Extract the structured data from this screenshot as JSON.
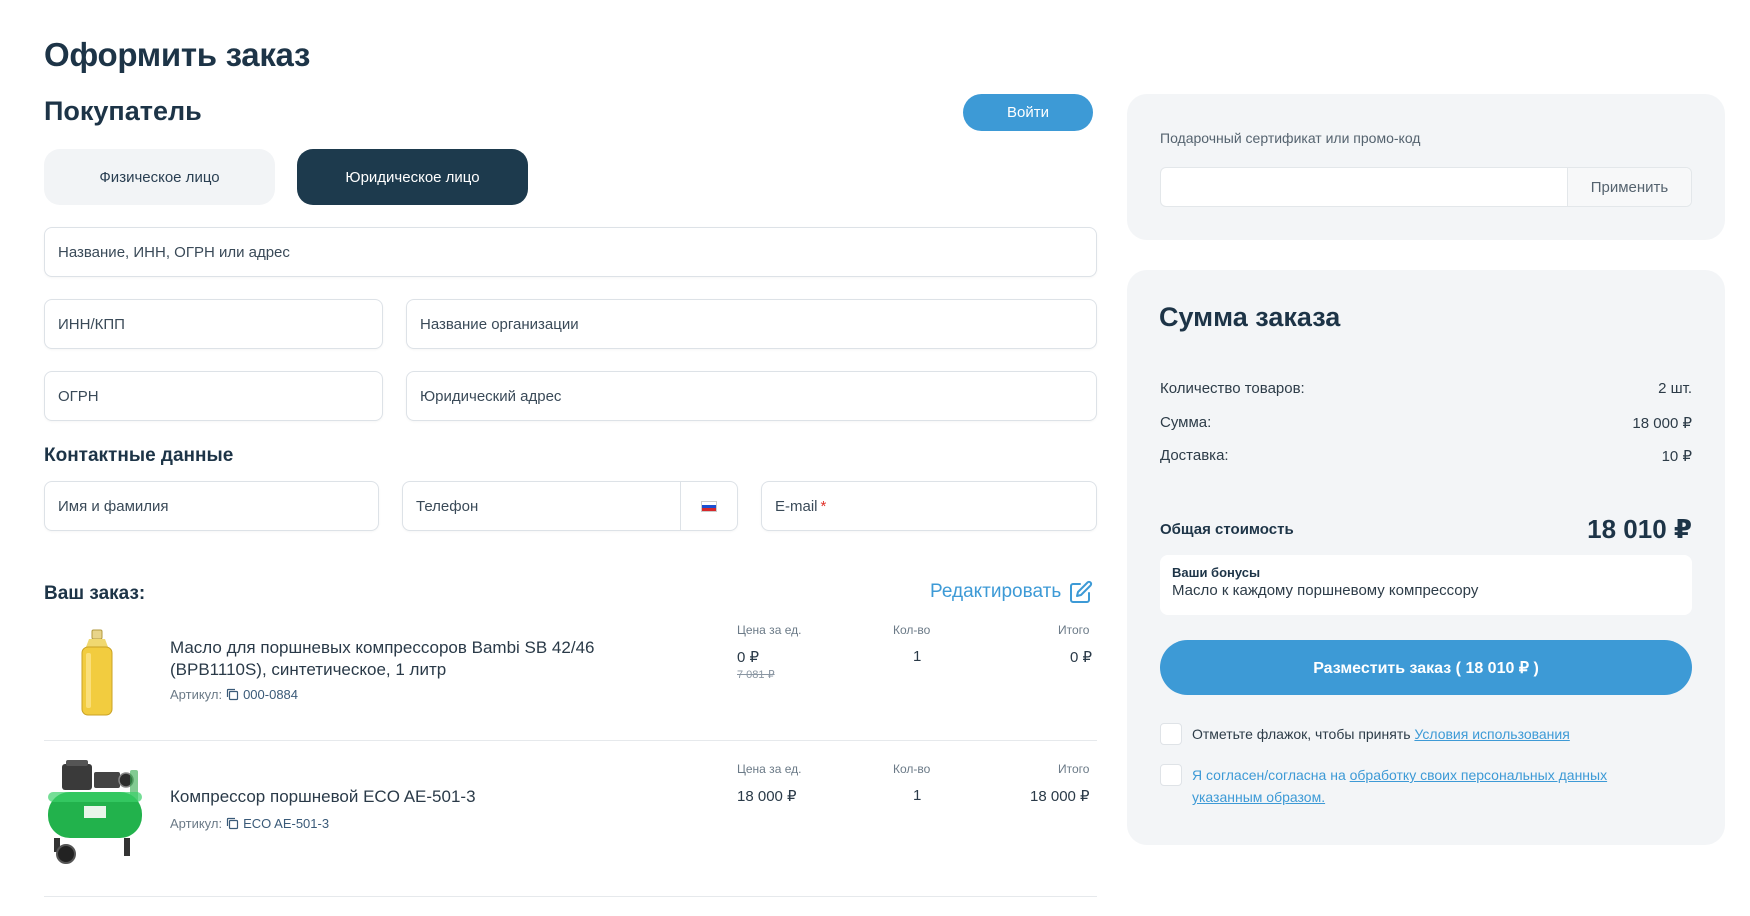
{
  "page": {
    "title": "Оформить заказ"
  },
  "buyer": {
    "title": "Покупатель",
    "login_label": "Войти",
    "tabs": [
      {
        "label": "Физическое лицо",
        "active": false
      },
      {
        "label": "Юридическое лицо",
        "active": true
      }
    ],
    "fields": {
      "search_placeholder": "Название, ИНН, ОГРН или адрес",
      "inn_kpp": "ИНН/КПП",
      "org_name": "Название организации",
      "ogrn": "ОГРН",
      "legal_address": "Юридический адрес"
    }
  },
  "contacts": {
    "title": "Контактные данные",
    "name_placeholder": "Имя и фамилия",
    "phone_placeholder": "Телефон",
    "email_placeholder": "E-mail",
    "email_required_mark": "*"
  },
  "order": {
    "title": "Ваш заказ:",
    "edit_label": "Редактировать",
    "columns": {
      "price": "Цена за ед.",
      "qty": "Кол-во",
      "total": "Итого"
    },
    "items": [
      {
        "name_line1": "Масло для поршневых компрессоров Bambi SB 42/46",
        "name_line2": "(BPB1110S), синтетическое, 1 литр",
        "sku_label": "Артикул:",
        "sku": "000-0884",
        "price": "0 ₽",
        "old_price": "7 081 ₽",
        "qty": "1",
        "total": "0 ₽",
        "image": "oil-bottle"
      },
      {
        "name_line1": "Компрессор поршневой ECO AE-501-3",
        "sku_label": "Артикул:",
        "sku": "ECO AE-501-3",
        "price": "18 000 ₽",
        "qty": "1",
        "total": "18 000 ₽",
        "image": "green-compressor"
      }
    ]
  },
  "promo": {
    "label": "Подарочный сертификат или промо-код",
    "value": "",
    "apply_label": "Применить"
  },
  "summary": {
    "title": "Сумма заказа",
    "rows": [
      {
        "label": "Количество товаров:",
        "value": "2 шт."
      },
      {
        "label": "Сумма:",
        "value": "18 000 ₽"
      },
      {
        "label": "Доставка:",
        "value": "10 ₽"
      }
    ],
    "total_label": "Общая стоимость",
    "total_value": "18 010 ₽",
    "bonus_title": "Ваши бонусы",
    "bonus_text": "Масло к каждому поршневому компрессору",
    "place_order_label": "Разместить заказ ( 18 010 ₽ )",
    "terms_text": "Отметьте флажок, чтобы принять",
    "terms_link": "Условия использования",
    "consent_text": "Я согласен/согласна на",
    "consent_link_1": "обработку своих персональных данных",
    "consent_link_2": "указанным образом."
  },
  "colors": {
    "accent": "#3d9ad6",
    "dark": "#1d3a4d",
    "panel": "#f3f5f7"
  }
}
